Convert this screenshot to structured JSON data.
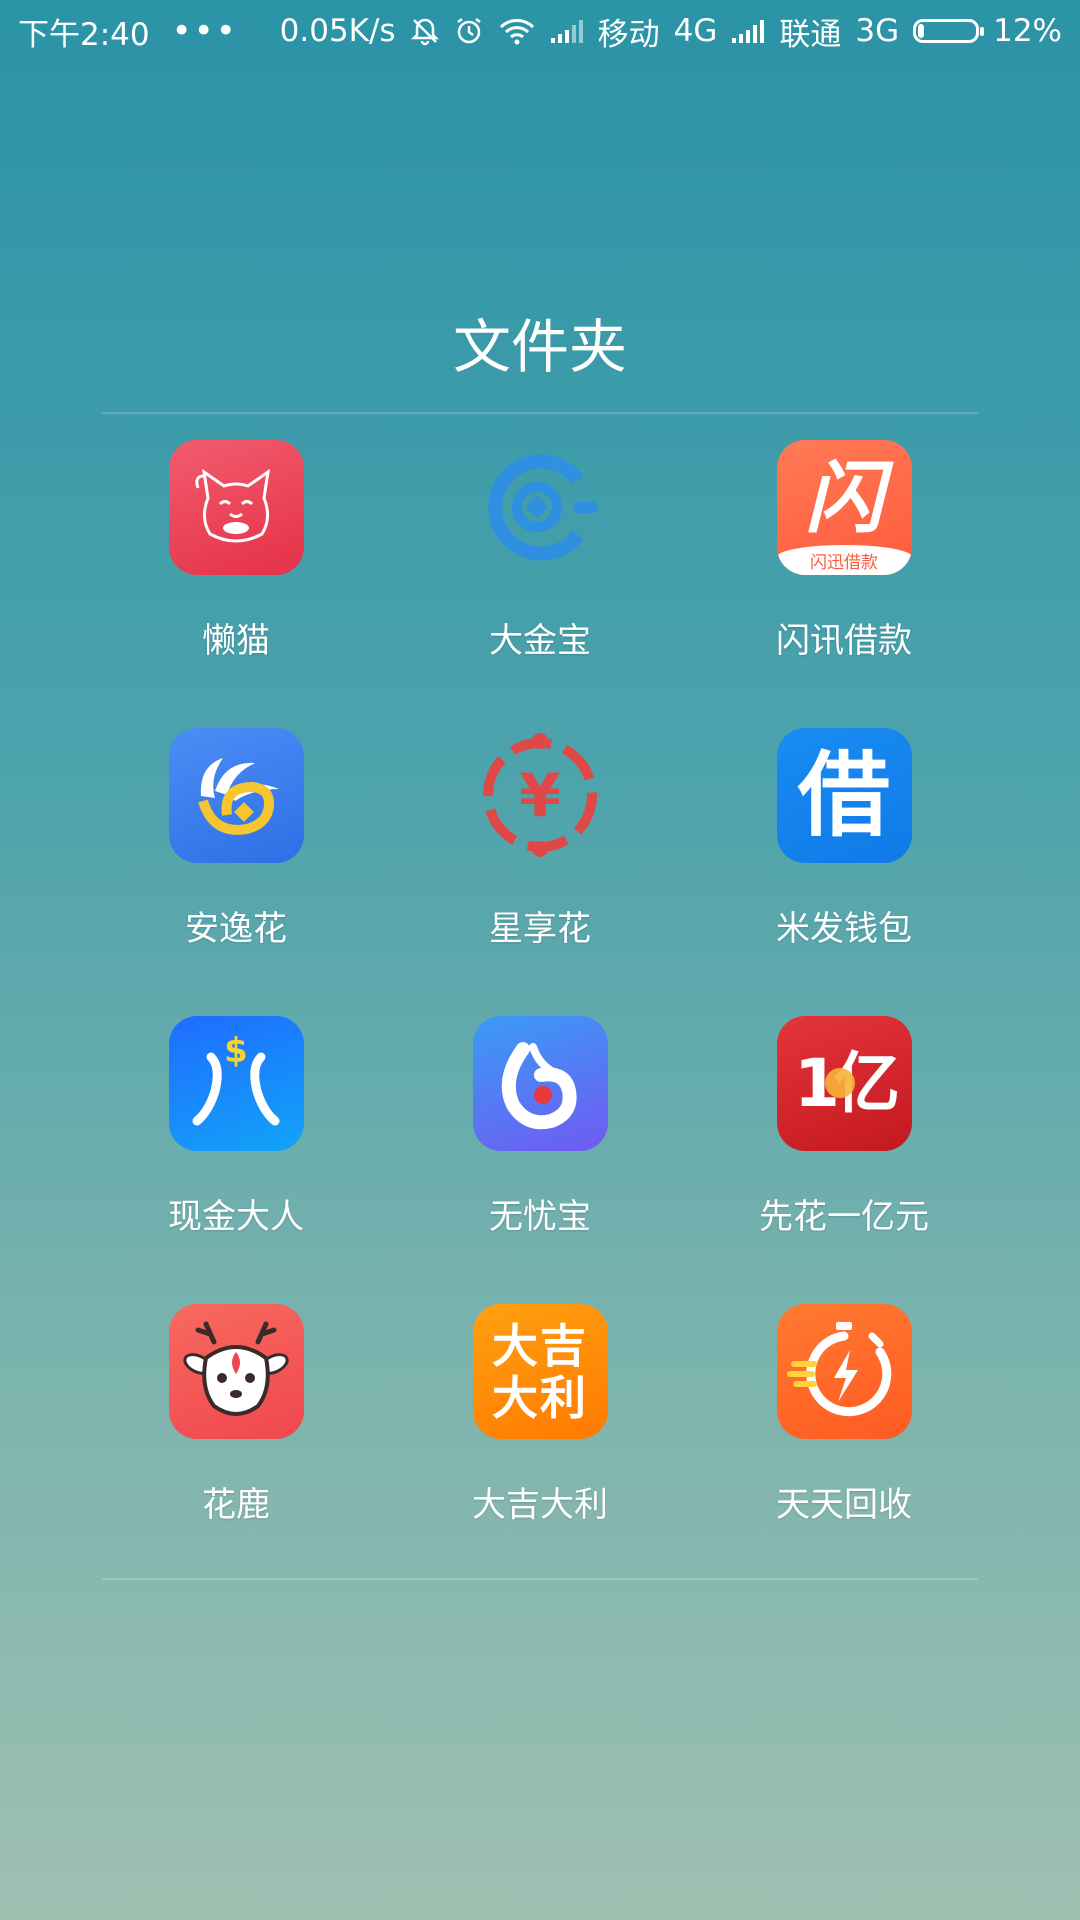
{
  "status_bar": {
    "time": "下午2:40",
    "dots": "•••",
    "speed": "0.05K/s",
    "carrier1": "移动",
    "network1": "4G",
    "carrier2": "联通",
    "network2": "3G",
    "battery": "12%"
  },
  "folder": {
    "title": "文件夹"
  },
  "apps": [
    {
      "label": "懒猫",
      "icon": "lucky-cat-icon",
      "color": "#e8485a"
    },
    {
      "label": "大金宝",
      "icon": "coin-c-icon",
      "color": "#2f8fe0"
    },
    {
      "label": "闪讯借款",
      "icon": "flash-loan-icon",
      "color": "#ff6a4a",
      "icon_text": "闪",
      "icon_subtext": "闪迅借款"
    },
    {
      "label": "安逸花",
      "icon": "petal-coin-icon",
      "color": "#3d7ff0"
    },
    {
      "label": "星享花",
      "icon": "yen-circle-icon",
      "color": "#e04848",
      "icon_text": "¥"
    },
    {
      "label": "米发钱包",
      "icon": "borrow-icon",
      "color": "#1e88f0",
      "icon_text": "借"
    },
    {
      "label": "现金大人",
      "icon": "cash-person-icon",
      "color": "#1a7cff",
      "icon_text": "$"
    },
    {
      "label": "无忧宝",
      "icon": "six-shield-icon",
      "color": "#4a6af5",
      "icon_text": "6"
    },
    {
      "label": "先花一亿元",
      "icon": "yi-icon",
      "color": "#d6262d",
      "icon_text": "1亿"
    },
    {
      "label": "花鹿",
      "icon": "deer-icon",
      "color": "#f25a57"
    },
    {
      "label": "大吉大利",
      "icon": "daji-dali-icon",
      "color": "#ff8a00",
      "icon_text_line1": "大吉",
      "icon_text_line2": "大利"
    },
    {
      "label": "天天回收",
      "icon": "stopwatch-bolt-icon",
      "color": "#ff6a2c"
    }
  ]
}
